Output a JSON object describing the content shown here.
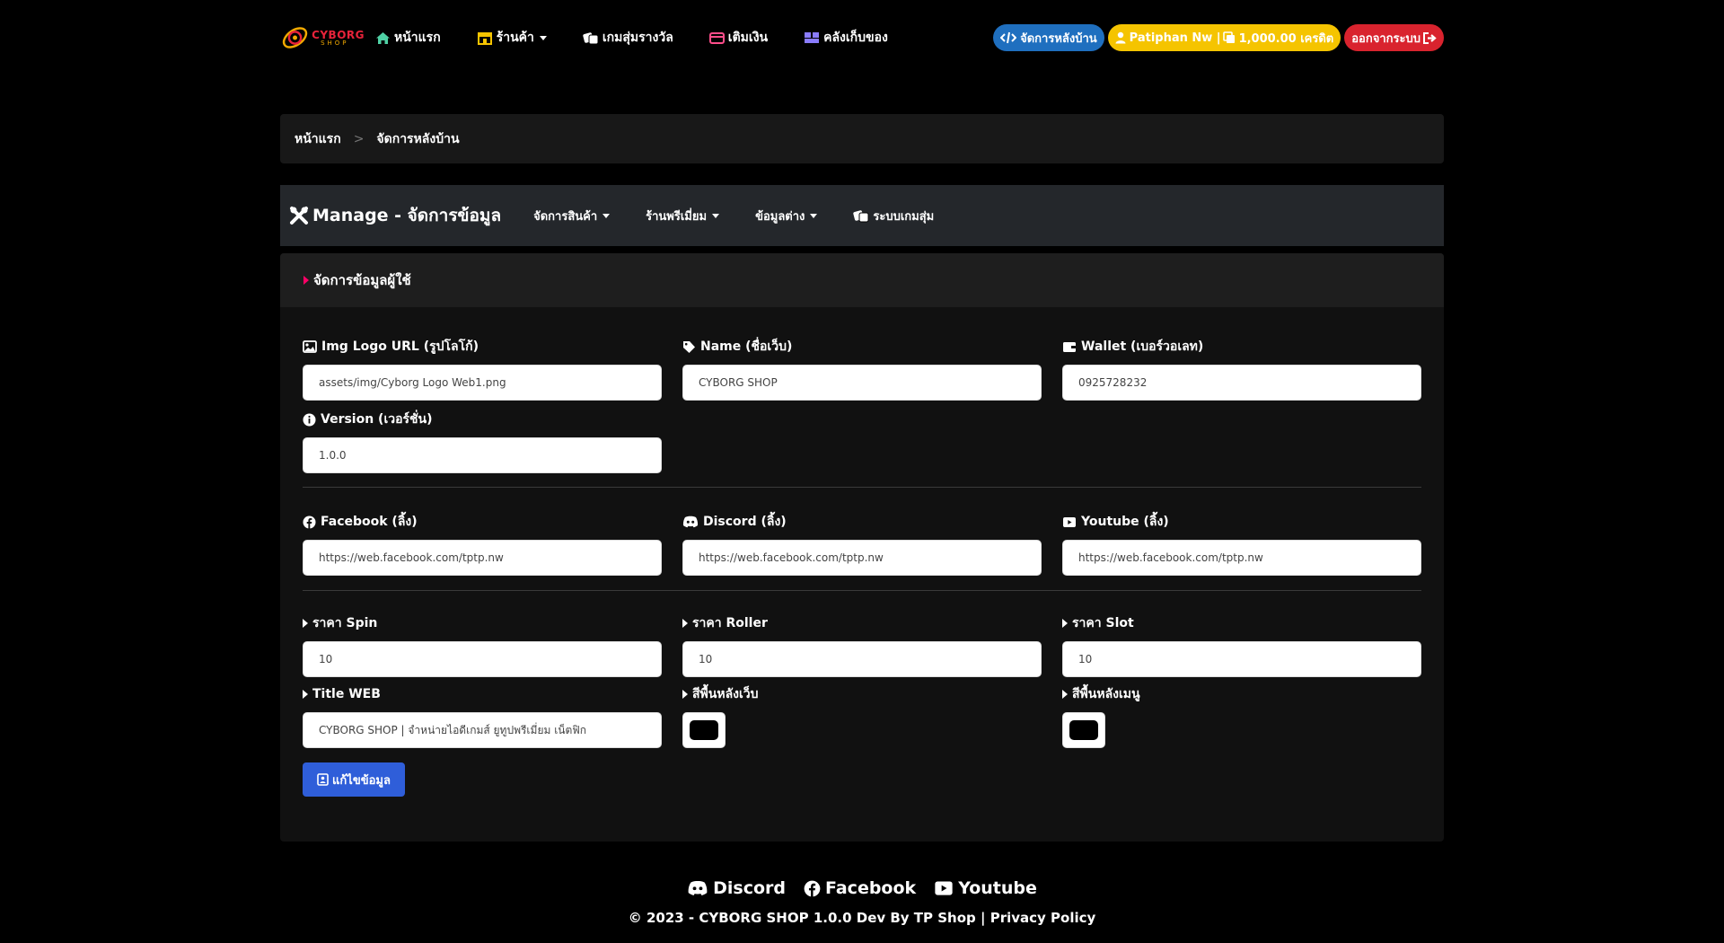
{
  "brand": {
    "line1": "CYBORG",
    "line2": "SHOP"
  },
  "nav": {
    "home": "หน้าแรก",
    "shop": "ร้านค้า",
    "gacha": "เกมสุ่มรางวัล",
    "topup": "เติมเงิน",
    "inventory": "คลังเก็บของ"
  },
  "nav_right": {
    "admin": "จัดการหลังบ้าน",
    "user": "Patiphan Nw | ",
    "credit": "1,000.00 เครดิต",
    "logout": "ออกจากระบบ"
  },
  "breadcrumb": {
    "home": "หน้าแรก",
    "separator": ">",
    "current": "จัดการหลังบ้าน"
  },
  "manage": {
    "title": "Manage - จัดการข้อมูล",
    "menu_products": "จัดการสินค้า",
    "menu_premium": "ร้านพรีเมี่ยม",
    "menu_misc": "ข้อมูลต่าง",
    "menu_gacha": "ระบบเกมสุ่ม"
  },
  "card": {
    "title": "จัดการข้อมูลผู้ใช้"
  },
  "form": {
    "logo_label": "Img Logo URL (รูปโลโก้)",
    "logo_value": "assets/img/Cyborg Logo Web1.png",
    "name_label": "Name (ชื่อเว็บ)",
    "name_value": "CYBORG SHOP",
    "wallet_label": "Wallet (เบอร์วอเลท)",
    "wallet_value": "0925728232",
    "version_label": "Version (เวอร์ชั่น)",
    "version_value": "1.0.0",
    "facebook_label": "Facebook (ลิ้ง)",
    "facebook_value": "https://web.facebook.com/tptp.nw",
    "discord_label": "Discord (ลิ้ง)",
    "discord_value": "https://web.facebook.com/tptp.nw",
    "youtube_label": "Youtube (ลิ้ง)",
    "youtube_value": "https://web.facebook.com/tptp.nw",
    "spin_label": "ราคา Spin",
    "spin_value": "10",
    "roller_label": "ราคา Roller",
    "roller_value": "10",
    "slot_label": "ราคา Slot",
    "slot_value": "10",
    "title_label": "Title WEB",
    "title_value": "CYBORG SHOP | จำหน่ายไอดีเกมส์ ยูทูปพรีเมี่ยม เน็ตฟิก",
    "bg_color_label": "สีพื้นหลังเว็บ",
    "bg_color_value": "#000000",
    "menu_color_label": "สีพื้นหลังเมนู",
    "menu_color_value": "#000000",
    "save_label": "แก้ไขข้อมูล"
  },
  "footer": {
    "discord": "Discord",
    "facebook": "Facebook",
    "youtube": "Youtube",
    "copyright": "© 2023 - CYBORG SHOP 1.0.0 Dev By TP Shop | Privacy Policy"
  },
  "colors": {
    "accent_blue": "#1f6fbf",
    "accent_yellow": "#f5c400",
    "accent_red": "#d9232e",
    "button_blue": "#2f5ed9"
  }
}
